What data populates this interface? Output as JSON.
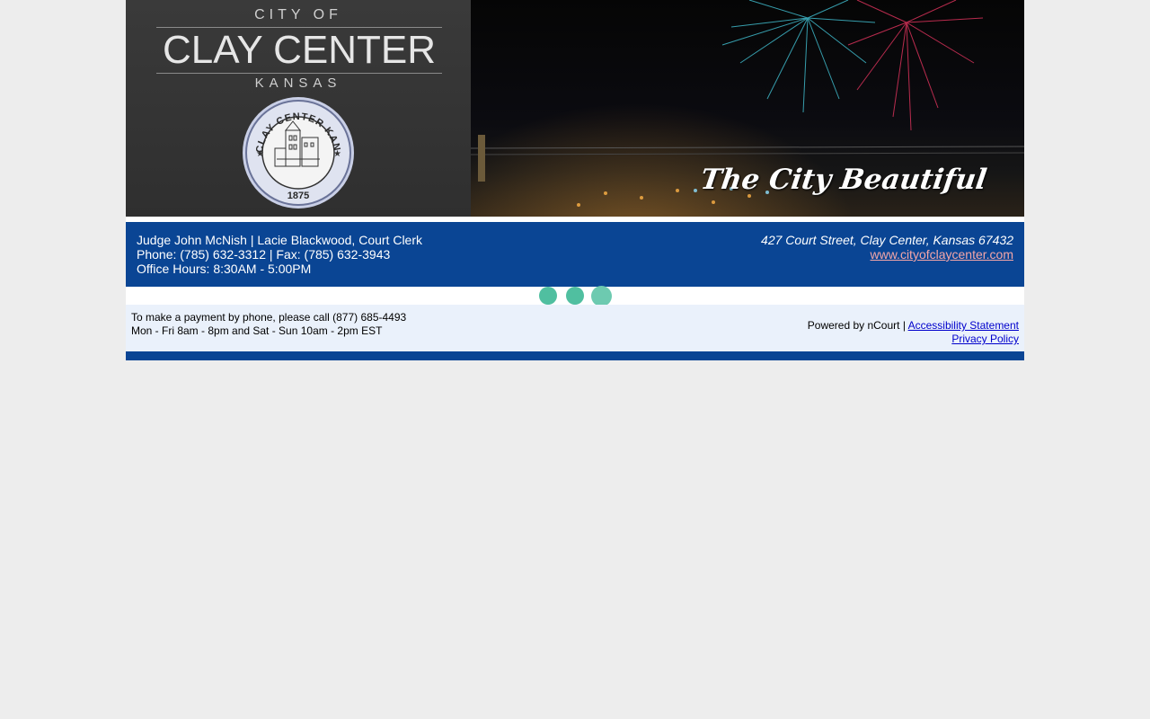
{
  "banner": {
    "city_of": "CITY OF",
    "city_name": "CLAY CENTER",
    "state": "KANSAS",
    "seal_text": "CLAY CENTER KANSAS",
    "seal_year": "1875",
    "tagline": "The City Beautiful"
  },
  "info": {
    "judge_line": "Judge John McNish | Lacie Blackwood, Court Clerk",
    "phone_line": "Phone: (785) 632-3312 | Fax: (785) 632-3943",
    "hours_line": "Office Hours: 8:30AM - 5:00PM",
    "address": "427 Court Street, Clay Center, Kansas 67432",
    "website": "www.cityofclaycenter.com"
  },
  "footer": {
    "phone_pay_line": "To make a payment by phone, please call (877) 685-4493",
    "pay_hours_line": "Mon - Fri 8am - 8pm and Sat - Sun 10am - 2pm EST",
    "powered_by": "Powered by nCourt |",
    "accessibility_link": "Accessibility Statement",
    "privacy_link": "Privacy Policy"
  },
  "colors": {
    "brand_blue": "#0a4594",
    "loader_dot": "#50bfa0",
    "footer_bg": "#eaf1fb",
    "page_bg": "#ededed"
  }
}
